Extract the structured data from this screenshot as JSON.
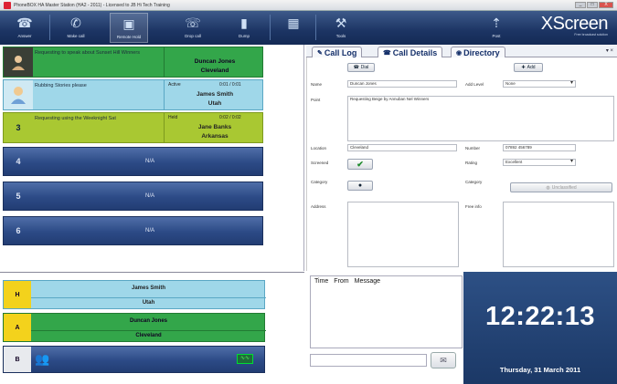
{
  "window": {
    "title": "PhoneBOX HA Master Station (HA2 - 2011) - Licensed to JB Hi Tech Training",
    "buttons": [
      "_",
      "□",
      "X"
    ]
  },
  "toolbar": {
    "items": [
      {
        "label": "Answer",
        "icon": "answer-icon"
      },
      {
        "label": "Make call",
        "icon": "make-call-icon"
      },
      {
        "label": "Remote Hold",
        "icon": "remote-hold-icon"
      },
      {
        "label": "Drop call",
        "icon": "drop-call-icon"
      },
      {
        "label": "Dump",
        "icon": "dump-icon"
      },
      {
        "label": "",
        "icon": "grid-icon"
      },
      {
        "label": "Tools",
        "icon": "tools-icon"
      },
      {
        "label": "Post",
        "icon": "post-icon"
      }
    ],
    "brand": "XScreen",
    "brand_sub": "Free broadcast solution"
  },
  "lines": [
    {
      "number": "",
      "message": "Requesting to speak about Sunset Hill Winners",
      "status": "",
      "time": "",
      "name": "Duncan Jones",
      "location": "Cleveland",
      "color": "#33a64a"
    },
    {
      "number": "",
      "message": "Rubbing Stories please",
      "status": "Active",
      "time": "0:01 / 0:01",
      "name": "James Smith",
      "location": "Utah",
      "color": "#9fd7e9"
    },
    {
      "number": "3",
      "message": "Requesting using the Weeknight Sat",
      "status": "Held",
      "time": "0:02 / 0:02",
      "name": "Jane Banks",
      "location": "Arkansas",
      "color": "#a9c832"
    },
    {
      "number": "4",
      "message": "",
      "na": "N/A",
      "color": "#2c4a86"
    },
    {
      "number": "5",
      "message": "",
      "na": "N/A",
      "color": "#2c4a86"
    },
    {
      "number": "6",
      "message": "",
      "na": "N/A",
      "color": "#2c4a86"
    }
  ],
  "tabs": [
    {
      "label": "Call Log",
      "icon": "call-log-icon"
    },
    {
      "label": "Call Details",
      "icon": "call-details-icon",
      "active": true
    },
    {
      "label": "Directory",
      "icon": "directory-icon"
    }
  ],
  "details": {
    "dial_label": "Dial",
    "add_label": "Add",
    "name_label": "Name",
    "name_value": "Duncan Jones",
    "add_level_label": "Add Level",
    "add_level_value": "None",
    "point_label": "Point",
    "point_value": "Requesting Beige by Annuban Nel Winners",
    "location_label": "Location",
    "location_value": "Cleveland",
    "number_label": "Number",
    "number_value": "07892 456789",
    "screened_label": "Screened",
    "rating_label": "Rating",
    "rating_value": "Excellent",
    "category_label": "Category",
    "category_label_2": "Category",
    "category_button": "Unclassified",
    "address_label": "Address",
    "free_info_label": "Free info"
  },
  "holds": [
    {
      "tag": "H",
      "name": "James Smith",
      "location": "Utah",
      "color": "#9fd7e9",
      "tag_color": "#f3d21c"
    },
    {
      "tag": "A",
      "name": "Duncan Jones",
      "location": "Cleveland",
      "color": "#33a64a",
      "tag_color": "#f3d21c"
    },
    {
      "tag": "B",
      "name": "",
      "location": "",
      "color": "#2c4a86",
      "tag_color": "#e8eaee"
    }
  ],
  "messages": {
    "headers": [
      "Time",
      "From",
      "Message"
    ],
    "input_placeholder": ""
  },
  "clock": {
    "time": "12:22:13",
    "date": "Thursday, 31 March 2011"
  }
}
